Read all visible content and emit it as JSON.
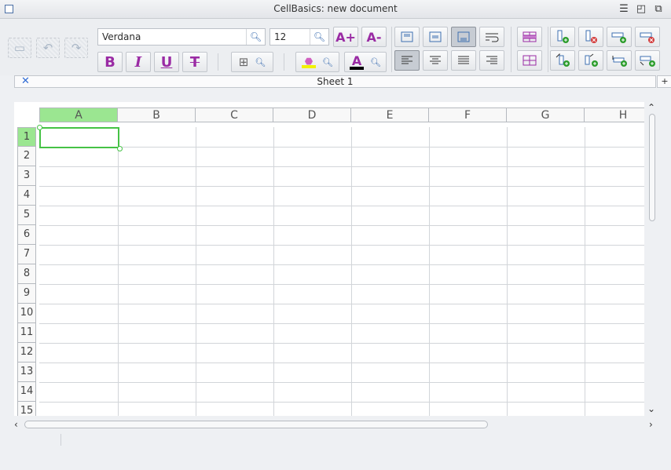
{
  "window": {
    "title": "CellBasics: new document"
  },
  "toolbar": {
    "font_name": "Verdana",
    "font_size": "12",
    "bold_label": "B",
    "italic_label": "I",
    "underline_label": "U",
    "strike_label": "T",
    "grow_label": "A+",
    "shrink_label": "A-",
    "font_color_label": "A"
  },
  "sheet": {
    "tab_name": "Sheet 1",
    "columns": [
      "A",
      "B",
      "C",
      "D",
      "E",
      "F",
      "G",
      "H"
    ],
    "rows": [
      "1",
      "2",
      "3",
      "4",
      "5",
      "6",
      "7",
      "8",
      "9",
      "10",
      "11",
      "12",
      "13",
      "14",
      "15"
    ],
    "selected_cell": "A1"
  },
  "colors": {
    "selection": "#45c245",
    "selected_header": "#9be691",
    "accent": "#9a2ba4"
  }
}
